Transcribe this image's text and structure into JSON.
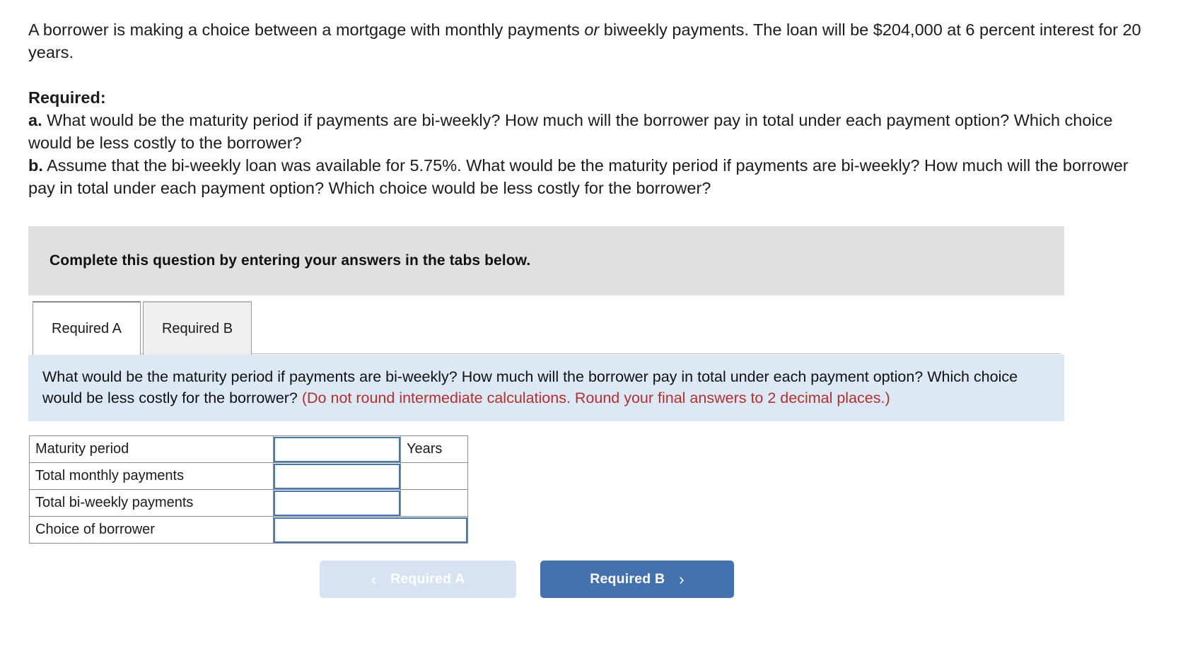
{
  "problem": {
    "stem_part1": "A borrower is making a choice between a mortgage with monthly payments ",
    "stem_italic": "or",
    "stem_part2": " biweekly payments. The loan will be $204,000 at 6 percent interest for 20 years."
  },
  "required": {
    "heading": "Required:",
    "item_a_marker": "a.",
    "item_a_text": " What would be the maturity period if payments are bi-weekly? How much will the borrower pay in total under each payment option? Which choice would be less costly to the borrower?",
    "item_b_marker": "b.",
    "item_b_text": " Assume that the bi-weekly loan was available for 5.75%. What would be the maturity period if payments are bi-weekly? How much will the borrower pay in total under each payment option? Which choice would be less costly for the borrower?"
  },
  "banner": {
    "text": "Complete this question by entering your answers in the tabs below."
  },
  "tabs": [
    {
      "label": "Required A",
      "active": true
    },
    {
      "label": "Required B",
      "active": false
    }
  ],
  "question_panel": {
    "main_text": "What would be the maturity period if payments are bi-weekly? How much will the borrower pay in total under each payment option? Which choice would be less costly for the borrower? ",
    "note_text": "(Do not round intermediate calculations. Round your final answers to 2 decimal places.)",
    "note_color": "#b03030",
    "background_color": "#dde8f5"
  },
  "answer_table": {
    "rows": [
      {
        "label": "Maturity period",
        "value": "",
        "unit": "Years"
      },
      {
        "label": "Total monthly payments",
        "value": "",
        "unit": ""
      },
      {
        "label": "Total bi-weekly payments",
        "value": "",
        "unit": ""
      },
      {
        "label": "Choice of borrower",
        "value": "",
        "unit": ""
      }
    ]
  },
  "navigation": {
    "prev_label": "Required A",
    "prev_icon": "chevron-left-icon",
    "next_label": "Required B",
    "next_icon": "chevron-right-icon",
    "prev_color": "#d7e3f2",
    "next_color": "#4472ad"
  }
}
